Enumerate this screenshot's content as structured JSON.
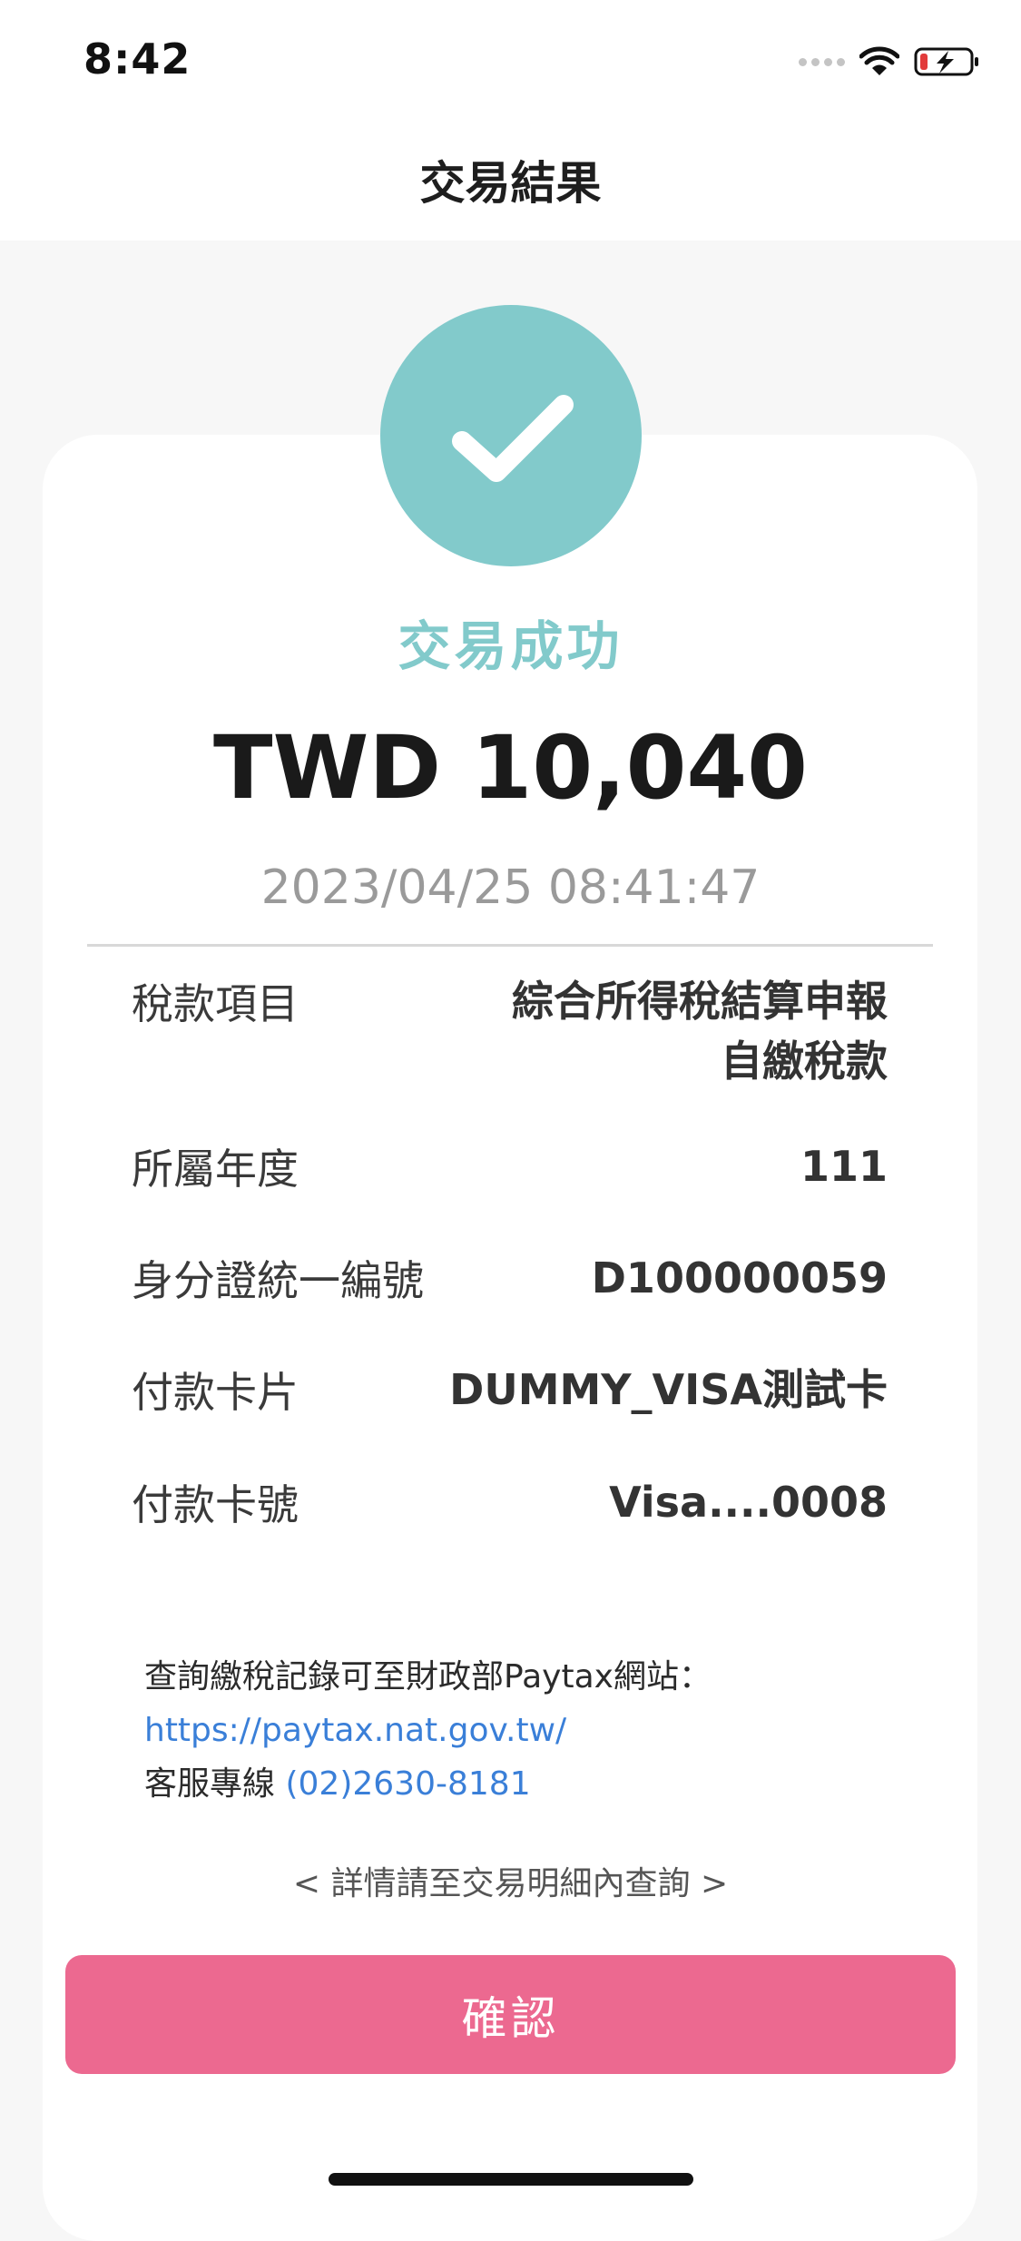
{
  "status_bar": {
    "time": "8:42"
  },
  "nav": {
    "title": "交易結果"
  },
  "result": {
    "status": "交易成功",
    "amount": "TWD 10,040",
    "datetime": "2023/04/25 08:41:47"
  },
  "details": [
    {
      "label": "稅款項目",
      "value_line1": "綜合所得稅結算申報",
      "value_line2": "自繳稅款"
    },
    {
      "label": "所屬年度",
      "value_line1": "111"
    },
    {
      "label": "身分證統一編號",
      "value_line1": "D100000059"
    },
    {
      "label": "付款卡片",
      "value_line1": "DUMMY_VISA測試卡"
    },
    {
      "label": "付款卡號",
      "value_line1": "Visa....0008"
    }
  ],
  "info": {
    "query_text": "查詢繳稅記錄可至財政部Paytax網站：",
    "query_link": "https://paytax.nat.gov.tw/",
    "hotline_label": "客服專線",
    "hotline_number": "(02)2630-8181"
  },
  "more_link": "< 詳情請至交易明細內查詢 >",
  "confirm_label": "確認",
  "colors": {
    "success_teal": "#82cacb",
    "confirm_pink": "#ec6990",
    "link_blue": "#3a7fd8"
  },
  "icons": {
    "status": [
      "signal-dots-icon",
      "wifi-icon",
      "battery-charging-icon"
    ],
    "result": "checkmark-icon"
  }
}
